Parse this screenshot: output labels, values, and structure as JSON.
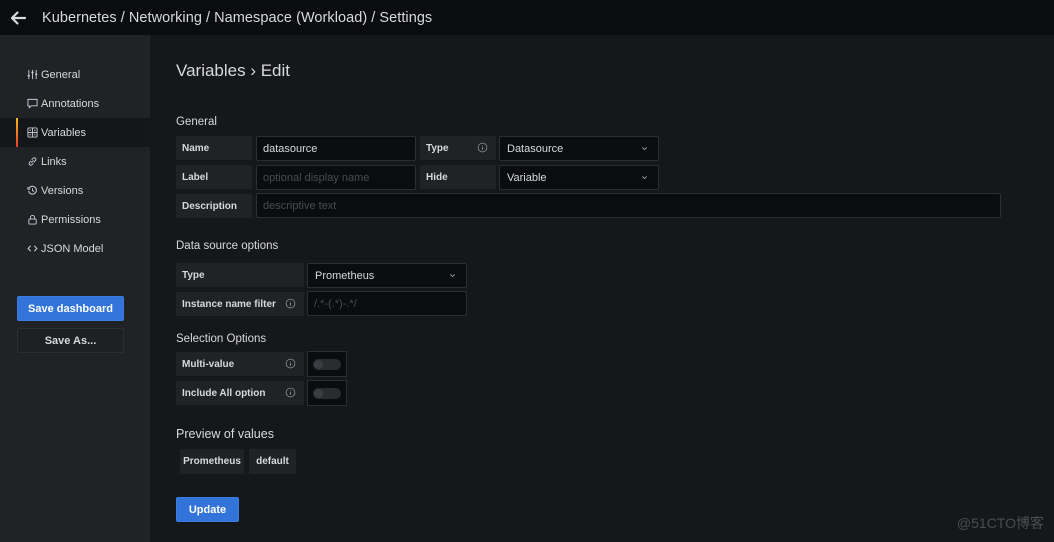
{
  "topbar": {
    "breadcrumb": "Kubernetes / Networking / Namespace (Workload) / Settings"
  },
  "sidebar": {
    "items": [
      {
        "label": "General",
        "icon": "sliders-icon",
        "active": false
      },
      {
        "label": "Annotations",
        "icon": "comment-icon",
        "active": false
      },
      {
        "label": "Variables",
        "icon": "calculator-icon",
        "active": true
      },
      {
        "label": "Links",
        "icon": "link-icon",
        "active": false
      },
      {
        "label": "Versions",
        "icon": "history-icon",
        "active": false
      },
      {
        "label": "Permissions",
        "icon": "lock-icon",
        "active": false
      },
      {
        "label": "JSON Model",
        "icon": "code-icon",
        "active": false
      }
    ],
    "save_label": "Save dashboard",
    "save_as_label": "Save As..."
  },
  "main": {
    "title": "Variables › Edit",
    "general": {
      "section": "General",
      "name_label": "Name",
      "name_value": "datasource",
      "type_label": "Type",
      "type_value": "Datasource",
      "label_label": "Label",
      "label_placeholder": "optional display name",
      "hide_label": "Hide",
      "hide_value": "Variable",
      "description_label": "Description",
      "description_placeholder": "descriptive text"
    },
    "datasource_options": {
      "section": "Data source options",
      "type_label": "Type",
      "type_value": "Prometheus",
      "filter_label": "Instance name filter",
      "filter_placeholder": "/.*-(.*)-.*/"
    },
    "selection_options": {
      "section": "Selection Options",
      "multi_label": "Multi-value",
      "multi_enabled": false,
      "include_all_label": "Include All option",
      "include_all_enabled": false
    },
    "preview": {
      "section": "Preview of values",
      "values": [
        "Prometheus",
        "default"
      ]
    },
    "update_label": "Update"
  },
  "watermark": "@51CTO博客",
  "colors": {
    "primary": "#3274d9",
    "active_indicator_top": "#f8b81f",
    "active_indicator_bottom": "#e43f24"
  }
}
